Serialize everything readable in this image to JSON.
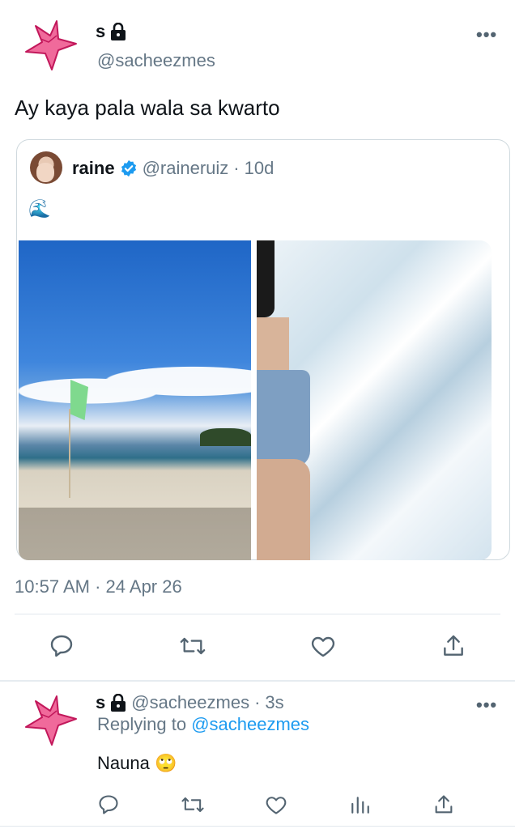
{
  "main_tweet": {
    "display_name": "s",
    "handle": "@sacheezmes",
    "text": "Ay kaya pala wala sa kwarto",
    "timestamp": "10:57 AM",
    "date": "24 Apr 26",
    "more_label": "•••"
  },
  "quoted_tweet": {
    "display_name": "raine",
    "handle": "@raineruiz",
    "separator": "·",
    "age": "10d",
    "text": "🌊",
    "photos": [
      "beach-shore-photo",
      "ocean-foam-photo"
    ]
  },
  "reply": {
    "display_name": "s",
    "handle": "@sacheezmes",
    "separator": "·",
    "age": "3s",
    "replying_to_label": "Replying to",
    "replying_to_handle": "@sacheezmes",
    "text": "Nauna",
    "emoji": "🙄",
    "more_label": "•••"
  },
  "colors": {
    "accent": "#1d9bf0",
    "muted": "#657786",
    "star_fill": "#f06a9b",
    "star_stroke": "#c2185b"
  }
}
